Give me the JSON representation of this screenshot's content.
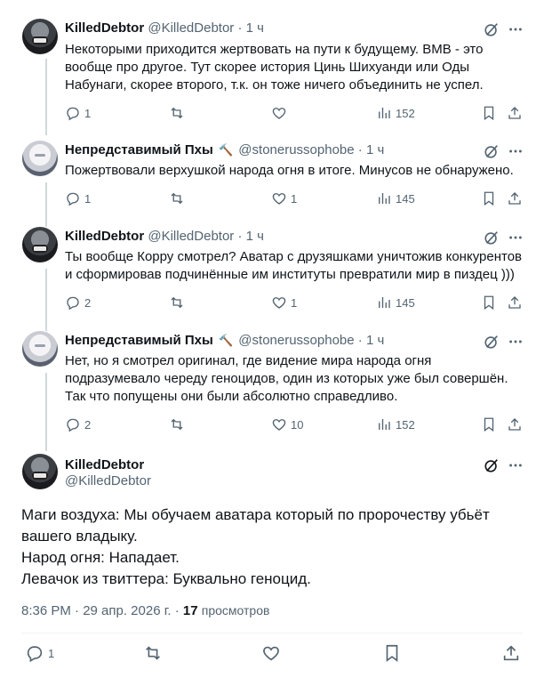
{
  "tweets": [
    {
      "name": "KilledDebtor",
      "handle": "@KilledDebtor",
      "time": "· 1 ч",
      "text": "Некоторыми приходится жертвовать на пути к будущему. ВМВ - это вообще про другое. Тут скорее история Цинь Шихуанди или Оды Набунаги, скорее второго, т.к. он тоже ничего объединить не успел.",
      "replies": "1",
      "retweets": "",
      "likes": "",
      "views": "152"
    },
    {
      "name": "Непредставимый Пхы",
      "handle": "@stonerussophobe",
      "time": "· 1 ч",
      "text": "Пожертвовали верхушкой народа огня в итоге. Минусов не обнаружено.",
      "replies": "1",
      "retweets": "",
      "likes": "1",
      "views": "145"
    },
    {
      "name": "KilledDebtor",
      "handle": "@KilledDebtor",
      "time": "· 1 ч",
      "text": "Ты вообще Корру смотрел? Аватар с друзяшками уничтожив конкурентов и сформировав подчинённые им институты превратили мир в пиздец )))",
      "replies": "2",
      "retweets": "",
      "likes": "1",
      "views": "145"
    },
    {
      "name": "Непредставимый Пхы",
      "handle": "@stonerussophobe",
      "time": "· 1 ч",
      "text": "Нет, но я смотрел оригинал, где видение мира народа огня подразумевало череду геноцидов, один из которых уже был совершён. Так что попущены они были абсолютно справедливо.",
      "replies": "2",
      "retweets": "",
      "likes": "10",
      "views": "152"
    }
  ],
  "main": {
    "name": "KilledDebtor",
    "handle": "@KilledDebtor",
    "lines": [
      "Маги воздуха: Мы обучаем аватара который по пророчеству убьёт вашего владыку.",
      "Народ огня: Нападает.",
      "Левачок из твиттера: Буквально геноцид."
    ],
    "datetime": "8:36 PM · 29 апр. 2026 г. · ",
    "views_count": "17",
    "views_label": "просмотров",
    "replies": "1"
  },
  "icons": {
    "grok": "grok-icon",
    "more": "more-icon",
    "reply": "reply-icon",
    "retweet": "retweet-icon",
    "like": "like-icon",
    "views": "views-icon",
    "bookmark": "bookmark-icon",
    "share": "share-icon"
  },
  "colors": {
    "text": "#0f1419",
    "muted": "#536471",
    "line": "#cfd9de"
  }
}
